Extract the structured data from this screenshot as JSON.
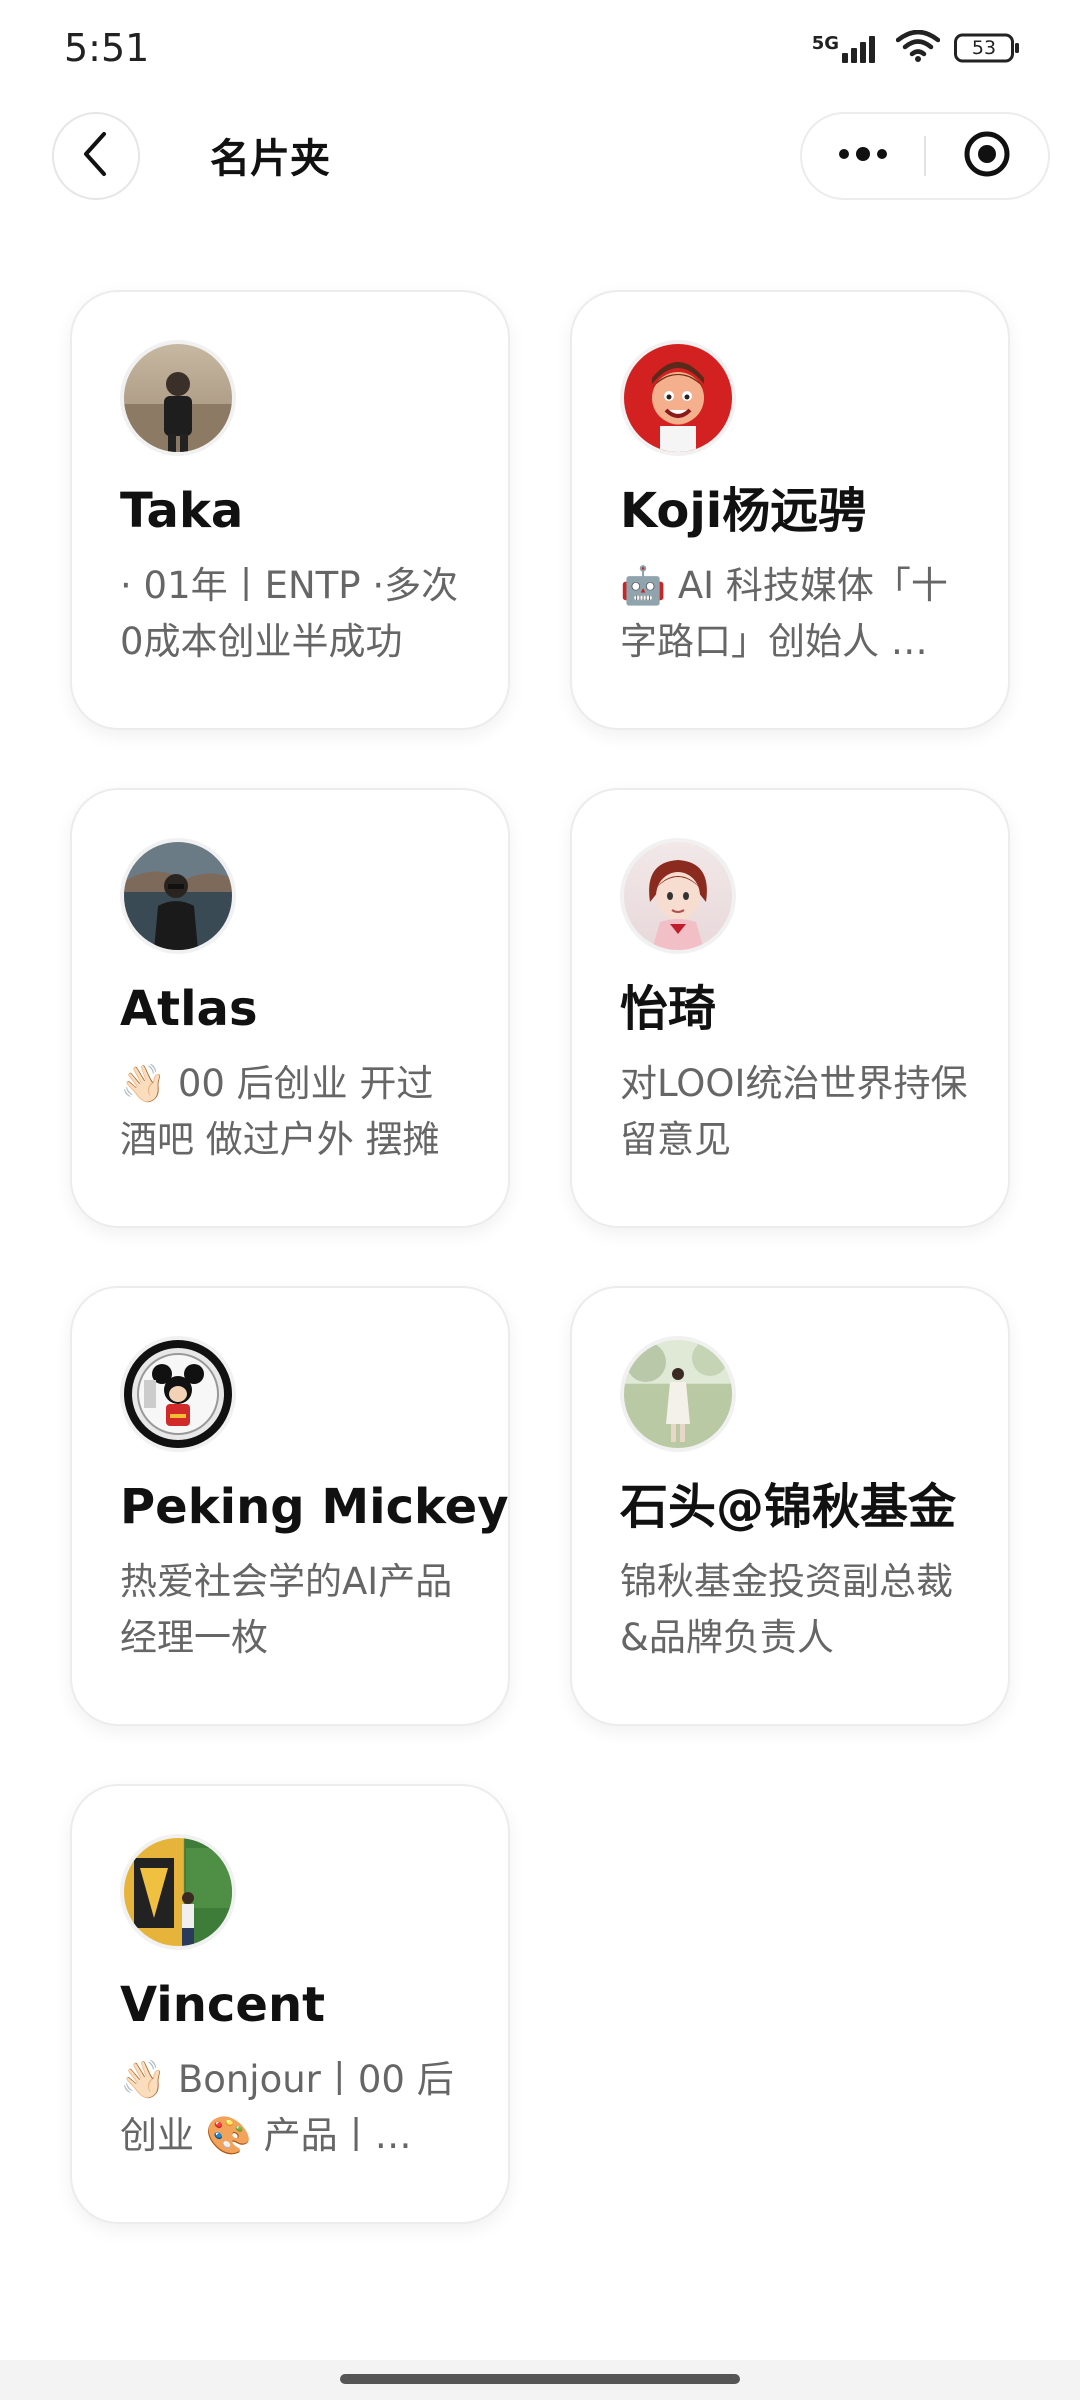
{
  "status_bar": {
    "time": "5:51",
    "network": "5G",
    "battery": "53"
  },
  "header": {
    "title": "名片夹"
  },
  "cards": [
    {
      "name": "Taka",
      "desc": "· 01年丨ENTP ·多次0成本创业半成功",
      "avatar": "taka-avatar"
    },
    {
      "name": "Koji杨远骋",
      "desc": "🤖 AI 科技媒体「十字路口」创始人 …",
      "avatar": "koji-avatar"
    },
    {
      "name": "Atlas",
      "desc": "👋🏻 00 后创业 开过酒吧 做过户外 摆摊",
      "avatar": "atlas-avatar"
    },
    {
      "name": "怡琦",
      "desc": "对LOOI统治世界持保留意见",
      "avatar": "yiqi-avatar"
    },
    {
      "name": "Peking Mickey",
      "desc": "热爱社会学的AI产品经理一枚",
      "avatar": "mickey-avatar"
    },
    {
      "name": "石头@锦秋基金",
      "desc": "锦秋基金投资副总裁&品牌负责人",
      "avatar": "stone-avatar"
    },
    {
      "name": "Vincent",
      "desc": "👋🏻 Bonjour丨00 后创业 🎨 产品丨…",
      "avatar": "vincent-avatar"
    }
  ]
}
